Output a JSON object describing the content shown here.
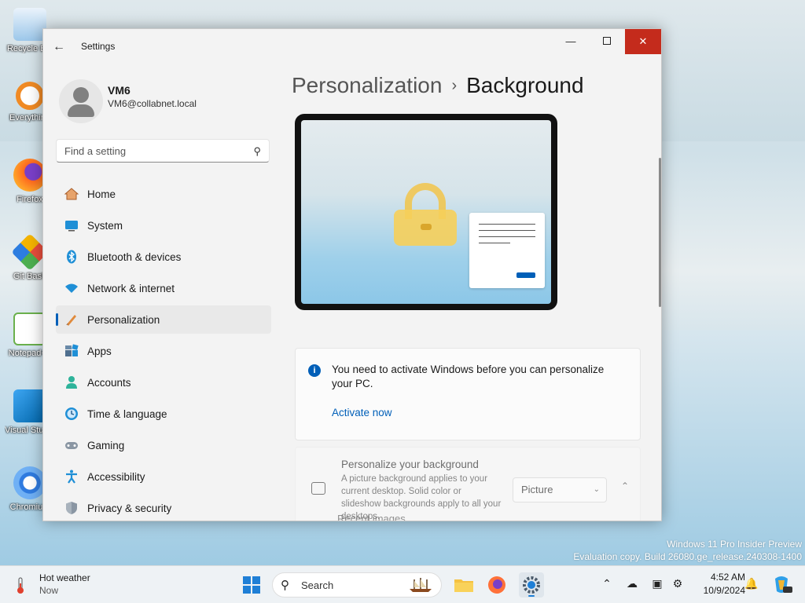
{
  "desktop": {
    "icons": [
      {
        "label": "Recycle Bin"
      },
      {
        "label": "Everything"
      },
      {
        "label": "Firefox"
      },
      {
        "label": "Git Bash"
      },
      {
        "label": "Notepad++"
      },
      {
        "label": "Visual Studio Code"
      },
      {
        "label": "Chromium"
      }
    ],
    "watermark_line1": "Windows 11 Pro Insider Preview",
    "watermark_line2": "Evaluation copy. Build 26080.ge_release.240308-1400"
  },
  "window": {
    "app_title": "Settings",
    "minimize_glyph": "—",
    "close_glyph": "✕"
  },
  "profile": {
    "name": "VM6",
    "email": "VM6@collabnet.local"
  },
  "search": {
    "placeholder": "Find a setting"
  },
  "nav": {
    "items": [
      {
        "label": "Home",
        "icon": "home-icon"
      },
      {
        "label": "System",
        "icon": "system-icon"
      },
      {
        "label": "Bluetooth & devices",
        "icon": "bluetooth-icon"
      },
      {
        "label": "Network & internet",
        "icon": "wifi-icon"
      },
      {
        "label": "Personalization",
        "icon": "brush-icon",
        "active": true
      },
      {
        "label": "Apps",
        "icon": "apps-icon"
      },
      {
        "label": "Accounts",
        "icon": "accounts-icon"
      },
      {
        "label": "Time & language",
        "icon": "clock-icon"
      },
      {
        "label": "Gaming",
        "icon": "gamepad-icon"
      },
      {
        "label": "Accessibility",
        "icon": "accessibility-icon"
      },
      {
        "label": "Privacy & security",
        "icon": "shield-icon"
      }
    ]
  },
  "main": {
    "breadcrumb_parent": "Personalization",
    "breadcrumb_separator": "›",
    "breadcrumb_current": "Background",
    "info_message": "You need to activate Windows before you can personalize your PC.",
    "info_link": "Activate now",
    "background_setting": {
      "title": "Personalize your background",
      "description": "A picture background applies to your current desktop. Solid color or slideshow backgrounds apply to all your desktops.",
      "selected": "Picture"
    },
    "recent_images_label": "Recent images"
  },
  "taskbar": {
    "weather_title": "Hot weather",
    "weather_sub": "Now",
    "search_label": "Search",
    "time": "4:52 AM",
    "date": "10/9/2024"
  },
  "colors": {
    "accent": "#005fb8",
    "close_red": "#c42b1c"
  }
}
